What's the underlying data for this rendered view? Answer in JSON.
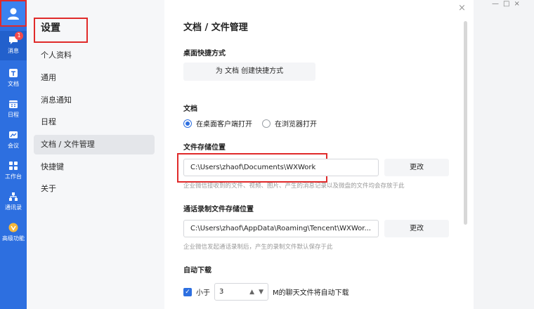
{
  "rail": {
    "items": [
      {
        "label": "消息",
        "badge": "1",
        "icon": "chat-bubble-icon"
      },
      {
        "label": "文档",
        "icon": "document-icon"
      },
      {
        "label": "日程",
        "icon": "calendar-icon"
      },
      {
        "label": "会议",
        "icon": "meeting-icon"
      },
      {
        "label": "工作台",
        "icon": "grid-icon"
      },
      {
        "label": "通讯录",
        "icon": "contacts-icon"
      },
      {
        "label": "高级功能",
        "icon": "vip-icon"
      }
    ]
  },
  "nav": {
    "title": "设置",
    "items": [
      {
        "label": "个人资料"
      },
      {
        "label": "通用"
      },
      {
        "label": "消息通知"
      },
      {
        "label": "日程"
      },
      {
        "label": "文档 / 文件管理"
      },
      {
        "label": "快捷键"
      },
      {
        "label": "关于"
      }
    ],
    "active_index": 4
  },
  "content": {
    "close_glyph": "×",
    "page_title": "文档 / 文件管理",
    "shortcut": {
      "title": "桌面快捷方式",
      "button": "为 文档 创建快捷方式"
    },
    "docs": {
      "title": "文档",
      "option_desktop": "在桌面客户端打开",
      "option_browser": "在浏览器打开",
      "selected": "desktop"
    },
    "file_storage": {
      "title": "文件存储位置",
      "path": "C:\\Users\\zhaof\\Documents\\WXWork",
      "change": "更改",
      "hint": "企业微信接收到的文件、视频、图片、产生的消息记录以及微盘的文件均会存放于此"
    },
    "call_storage": {
      "title": "通话录制文件存储位置",
      "path": "C:\\Users\\zhaof\\AppData\\Roaming\\Tencent\\WXWor...",
      "change": "更改",
      "hint": "企业微信发起通话录制后，产生的录制文件默认保存于此"
    },
    "auto_download": {
      "title": "自动下载",
      "checked": true,
      "prefix": "小于",
      "value": "3",
      "suffix": "M的聊天文件将自动下载"
    }
  },
  "colors": {
    "rail": "#2d6fe0",
    "accent": "#2d6fe0",
    "highlight": "#e02a2a"
  }
}
